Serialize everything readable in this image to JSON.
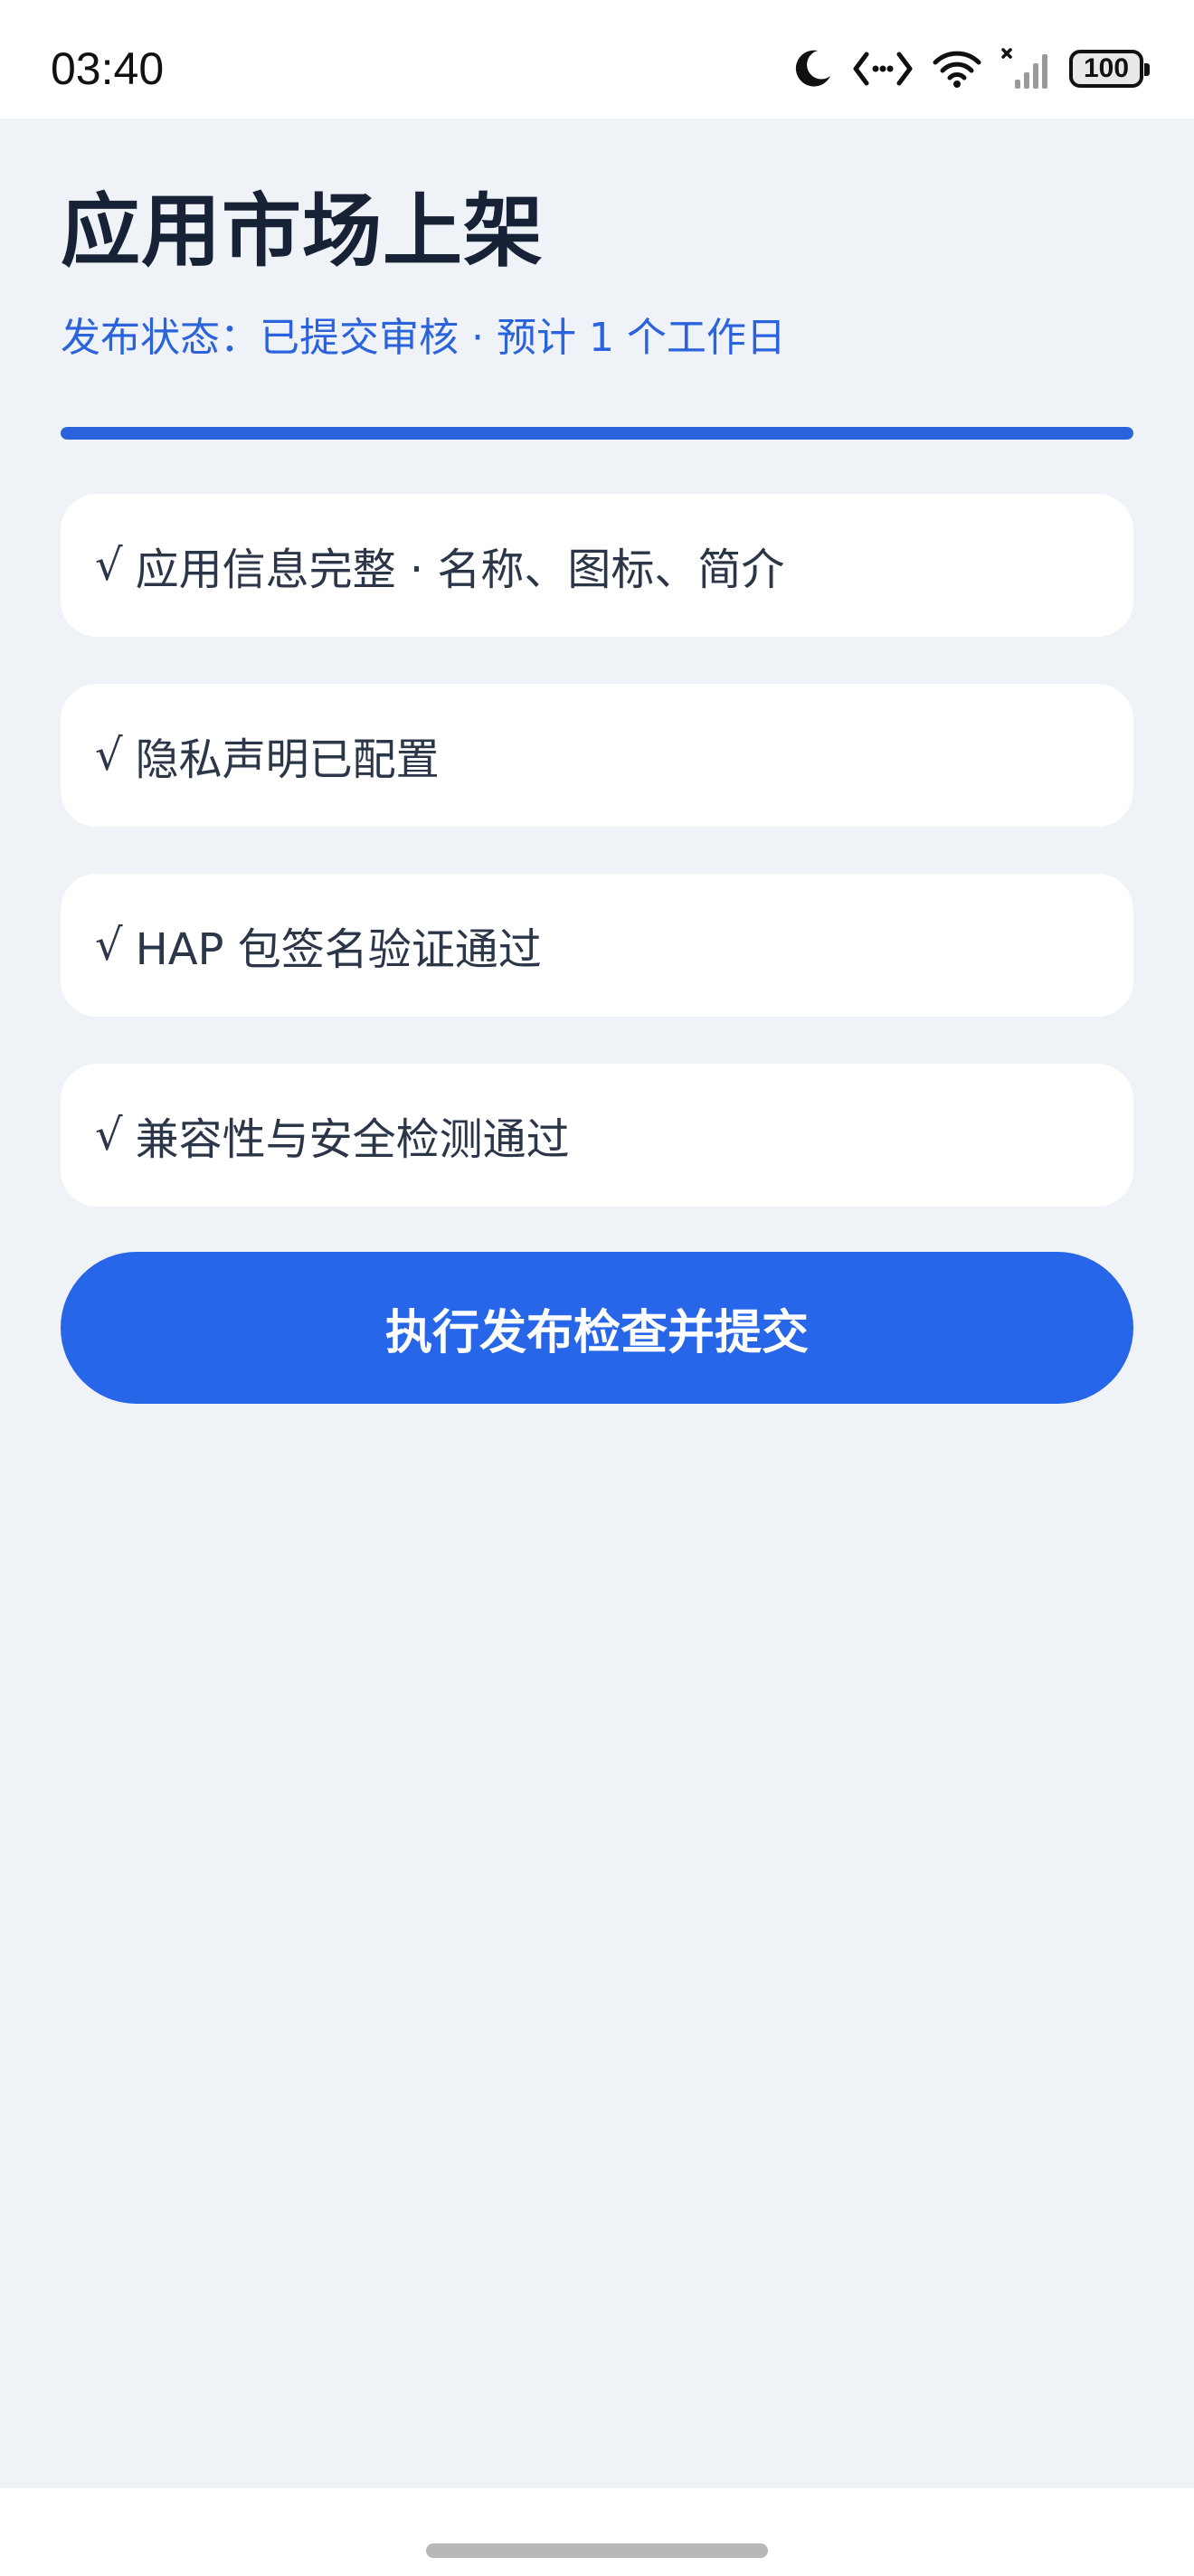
{
  "status_bar": {
    "time": "03:40",
    "icons": [
      "moon-icon",
      "code-brackets-icon",
      "wifi-icon",
      "cellular-signal-icon",
      "battery-icon"
    ],
    "battery_level": "100"
  },
  "page": {
    "title": "应用市场上架",
    "publish_status": "发布状态：已提交审核 · 预计 1 个工作日",
    "progress": 1.0
  },
  "checklist": [
    {
      "mark": "√",
      "label": "应用信息完整 · 名称、图标、简介"
    },
    {
      "mark": "√",
      "label": "隐私声明已配置"
    },
    {
      "mark": "√",
      "label": "HAP 包签名验证通过"
    },
    {
      "mark": "√",
      "label": "兼容性与安全检测通过"
    }
  ],
  "actions": {
    "submit_label": "执行发布检查并提交"
  },
  "colors": {
    "accent": "#2866e9",
    "background": "#eff3f8",
    "title": "#172236",
    "status_text": "#2b63dc"
  }
}
